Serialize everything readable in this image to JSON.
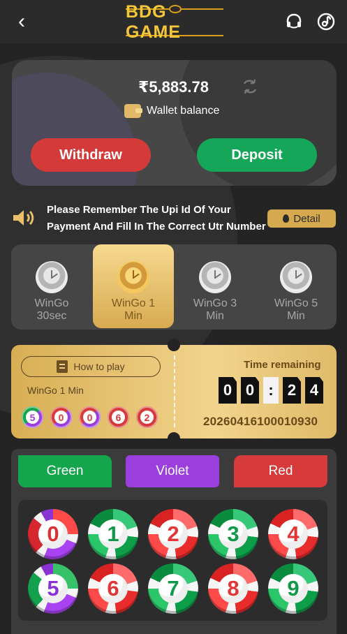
{
  "header": {
    "back_icon": "back-icon",
    "logo_text": "BDG GAME",
    "headset_icon": "headset-icon",
    "music_icon": "music-icon"
  },
  "wallet": {
    "balance": "₹5,883.78",
    "label": "Wallet balance",
    "withdraw": "Withdraw",
    "deposit": "Deposit"
  },
  "notice": {
    "text": "Please Remember The Upi Id Of Your Payment And Fill In The Correct Utr Number An",
    "detail": "Detail"
  },
  "tabs": [
    {
      "label": "WinGo 30sec",
      "line1": "WinGo",
      "line2": "30sec",
      "active": false
    },
    {
      "label": "WinGo 1 Min",
      "line1": "WinGo 1",
      "line2": "Min",
      "active": true
    },
    {
      "label": "WinGo 3 Min",
      "line1": "WinGo 3",
      "line2": "Min",
      "active": false
    },
    {
      "label": "WinGo 5 Min",
      "line1": "WinGo 5",
      "line2": "Min",
      "active": false
    }
  ],
  "ticket": {
    "how_to_play": "How to play",
    "mode": "WinGo 1 Min",
    "recent_results": [
      "5",
      "0",
      "0",
      "6",
      "2"
    ],
    "time_title": "Time remaining",
    "countdown": [
      "0",
      "0",
      ":",
      "2",
      "4"
    ],
    "period": "20260416100010930"
  },
  "bets": {
    "green": "Green",
    "violet": "Violet",
    "red": "Red",
    "numbers": [
      "0",
      "1",
      "2",
      "3",
      "4",
      "5",
      "6",
      "7",
      "8",
      "9"
    ]
  },
  "colors": {
    "background": "#242424",
    "gold": "#d8ae54",
    "green": "#15a54c",
    "violet": "#9a3fdd",
    "red": "#d73a3a"
  }
}
